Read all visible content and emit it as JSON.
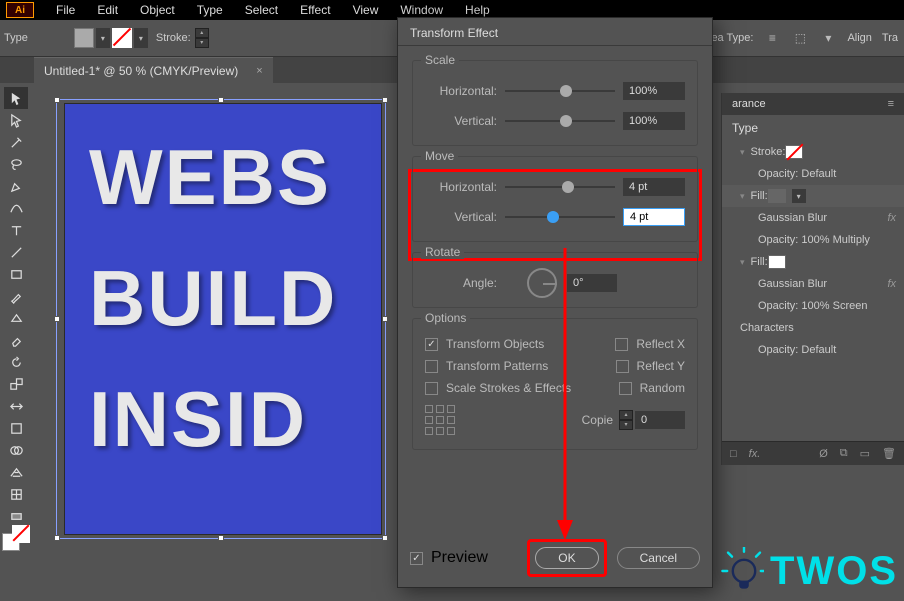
{
  "menubar": {
    "items": [
      "File",
      "Edit",
      "Object",
      "Type",
      "Select",
      "Effect",
      "View",
      "Window",
      "Help"
    ]
  },
  "controlbar": {
    "label_type": "Type",
    "label_stroke": "Stroke:",
    "label_area_type": "Area Type:",
    "label_align": "Align",
    "label_transform_right": "Tra"
  },
  "tab": {
    "title": "Untitled-1* @ 50 % (CMYK/Preview)"
  },
  "canvas": {
    "line1": "WEBS",
    "line2": "BUILD",
    "line3": "INSID"
  },
  "dialog": {
    "title": "Transform Effect",
    "scale": {
      "title": "Scale",
      "h_label": "Horizontal:",
      "v_label": "Vertical:",
      "h_value": "100%",
      "v_value": "100%"
    },
    "move": {
      "title": "Move",
      "h_label": "Horizontal:",
      "v_label": "Vertical:",
      "h_value": "4 pt",
      "v_value": "4 pt"
    },
    "rotate": {
      "title": "Rotate",
      "angle_label": "Angle:",
      "angle_value": "0°"
    },
    "options": {
      "title": "Options",
      "transform_objects": "Transform Objects",
      "transform_patterns": "Transform Patterns",
      "scale_strokes": "Scale Strokes & Effects",
      "reflect_x": "Reflect X",
      "reflect_y": "Reflect Y",
      "random": "Random",
      "copies_label": "Copie",
      "copies_value": "0"
    },
    "preview_label": "Preview",
    "ok": "OK",
    "cancel": "Cancel"
  },
  "appearance": {
    "panel_title": "arance",
    "type_header": "Type",
    "stroke_label": "Stroke:",
    "opacity_default": "Opacity:",
    "default_word": "Default",
    "fill_label": "Fill:",
    "gaussian_blur": "Gaussian Blur",
    "opacity_100_multiply": "100% Multiply",
    "opacity_100_screen": "100% Screen",
    "characters": "Characters",
    "fx_symbol": "fx"
  },
  "watermark": "TWOS"
}
